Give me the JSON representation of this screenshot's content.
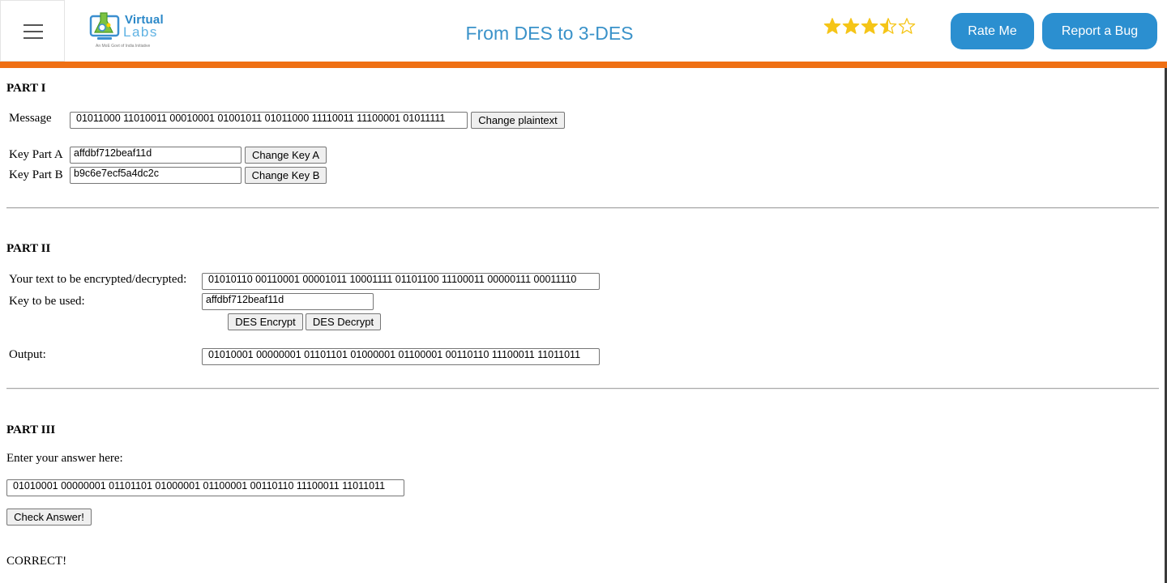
{
  "header": {
    "logo_virtual": "Virtual",
    "logo_labs": "Labs",
    "logo_tagline": "An MoE Govt of India Initiative",
    "title": "From DES to 3-DES",
    "rating": 3.5,
    "rating_max": 5,
    "rate_button": "Rate Me",
    "bug_button": "Report a Bug",
    "accent_color": "#ef6f13",
    "brand_color": "#2b8fd0"
  },
  "part1": {
    "title": "PART I",
    "message_label": "Message",
    "message_value": "01011000 11010011 00010001 01001011 01011000 11110011 11100001 01011111",
    "change_plaintext_button": "Change plaintext",
    "key_a_label": "Key Part A",
    "key_a_value": "affdbf712beaf11d",
    "change_key_a_button": "Change Key A",
    "key_b_label": "Key Part B",
    "key_b_value": "b9c6e7ecf5a4dc2c",
    "change_key_b_button": "Change Key B"
  },
  "part2": {
    "title": "PART II",
    "text_label": "Your text to be encrypted/decrypted:",
    "text_value": "01010110 00110001 00001011 10001111 01101100 11100011 00000111 00011110",
    "key_label": "Key to be used:",
    "key_value": "affdbf712beaf11d",
    "encrypt_button": "DES Encrypt",
    "decrypt_button": "DES Decrypt",
    "output_label": "Output:",
    "output_value": "01010001 00000001 01101101 01000001 01100001 00110110 11100011 11011011"
  },
  "part3": {
    "title": "PART III",
    "answer_label": "Enter your answer here:",
    "answer_value": "01010001 00000001 01101101 01000001 01100001 00110110 11100011 11011011",
    "check_button": "Check Answer!",
    "result": "CORRECT!"
  }
}
